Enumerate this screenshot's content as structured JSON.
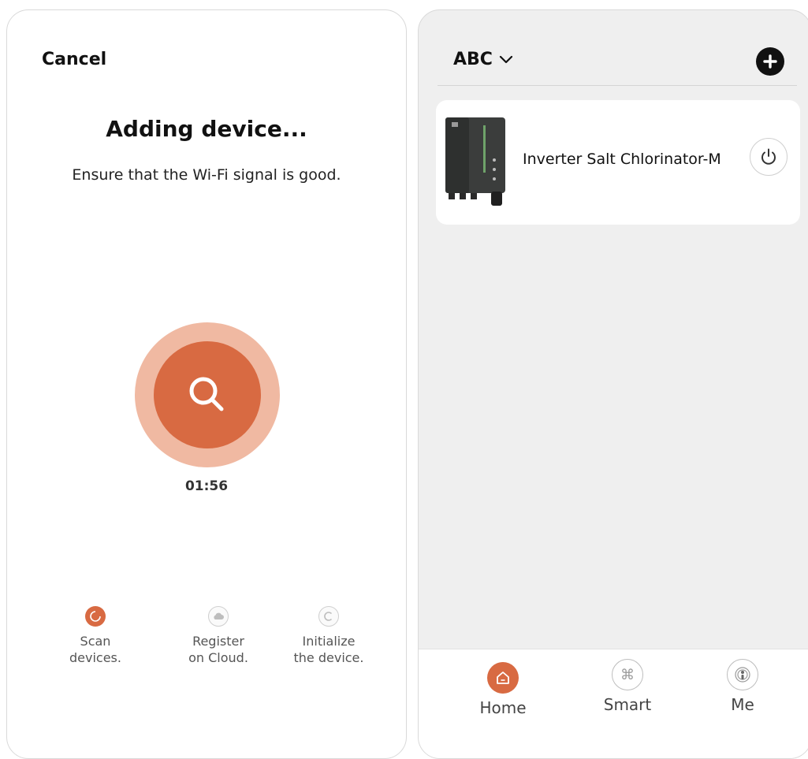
{
  "left": {
    "cancel_label": "Cancel",
    "title": "Adding device...",
    "subtitle": "Ensure that the Wi-Fi signal is good.",
    "timer": "01:56",
    "steps": [
      {
        "line1": "Scan",
        "line2": "devices.",
        "state": "active",
        "icon": "spinner-icon"
      },
      {
        "line1": "Register",
        "line2": "on Cloud.",
        "state": "pending",
        "icon": "cloud-icon"
      },
      {
        "line1": "Initialize",
        "line2": "the device.",
        "state": "pending",
        "icon": "initialize-icon"
      }
    ],
    "accent_color": "#d86a42",
    "ring_color": "#f0b9a2"
  },
  "right": {
    "home_name": "ABC",
    "device": {
      "name": "Inverter Salt Chlorinator-M",
      "icon": "power-icon"
    },
    "tabs": [
      {
        "label": "Home",
        "icon": "home-icon",
        "active": true
      },
      {
        "label": "Smart",
        "icon": "command-icon",
        "active": false
      },
      {
        "label": "Me",
        "icon": "person-icon",
        "active": false
      }
    ],
    "background_color": "#efefef"
  }
}
